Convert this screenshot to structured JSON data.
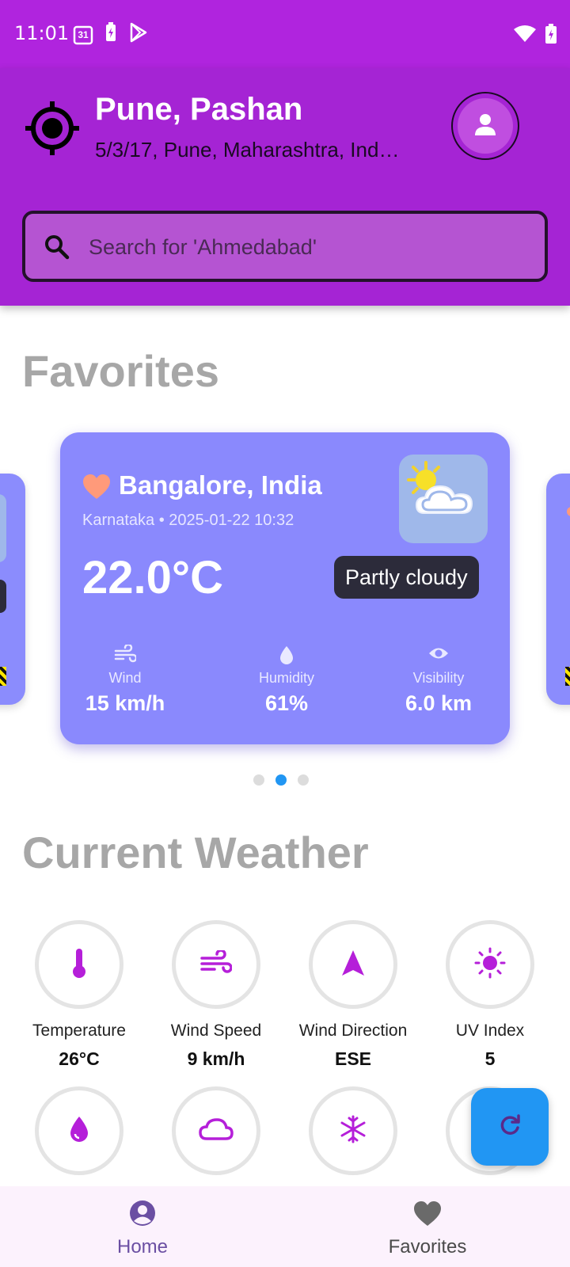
{
  "status_bar": {
    "time": "11:01",
    "calendar_day": "31",
    "icons_left": [
      "calendar-icon",
      "battery-saver-icon",
      "play-store-icon"
    ],
    "icons_right": [
      "wifi-icon",
      "battery-charging-icon"
    ]
  },
  "header": {
    "location_title": "Pune, Pashan",
    "location_subtitle": "5/3/17, Pune, Maharashtra, Ind…",
    "locate_icon": "my-location-icon",
    "avatar_icon": "person-icon"
  },
  "search": {
    "placeholder": "Search for 'Ahmedabad'",
    "value": ""
  },
  "favorites": {
    "title": "Favorites",
    "active_index": 1,
    "page_count": 3,
    "card": {
      "city": "Bangalore, India",
      "meta": "Karnataka • 2025-01-22 10:32",
      "temperature": "22.0°C",
      "condition": "Partly cloudy",
      "condition_icon": "partly-cloudy-icon",
      "stats": [
        {
          "icon": "wind-icon",
          "label": "Wind",
          "value": "15 km/h"
        },
        {
          "icon": "water-drop-icon",
          "label": "Humidity",
          "value": "61%"
        },
        {
          "icon": "eye-icon",
          "label": "Visibility",
          "value": "6.0 km"
        }
      ]
    }
  },
  "current_weather": {
    "title": "Current Weather",
    "metrics": [
      {
        "icon": "thermometer-icon",
        "label": "Temperature",
        "value": "26°C"
      },
      {
        "icon": "wind-icon",
        "label": "Wind Speed",
        "value": "9 km/h"
      },
      {
        "icon": "navigation-arrow-icon",
        "label": "Wind Direction",
        "value": "ESE"
      },
      {
        "icon": "sun-icon",
        "label": "UV Index",
        "value": "5"
      }
    ],
    "more_icons": [
      "water-drop-icon",
      "cloud-icon",
      "snowflake-icon"
    ]
  },
  "fab": {
    "icon": "refresh-icon"
  },
  "bottom_nav": {
    "items": [
      {
        "label": "Home",
        "icon": "account-circle-icon",
        "active": true
      },
      {
        "label": "Favorites",
        "icon": "heart-icon",
        "active": false
      }
    ]
  },
  "colors": {
    "status_bar": "#b024de",
    "header": "#a524d4",
    "card": "#8a89fd",
    "accent_purple": "#b51fd9",
    "fab": "#2196f3",
    "nav_active": "#6b4fa3"
  }
}
